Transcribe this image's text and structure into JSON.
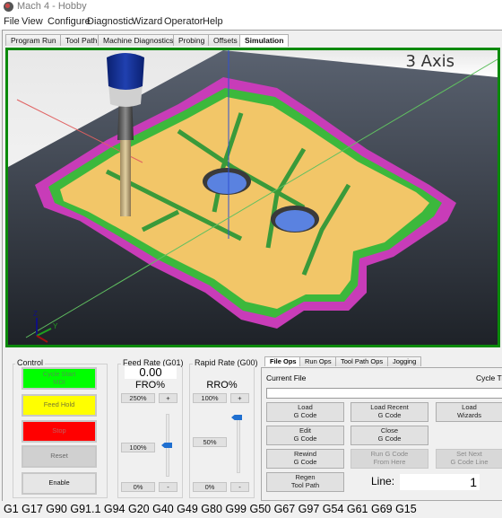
{
  "window": {
    "title": "Mach 4 - Hobby",
    "icon": "mach4-app-icon"
  },
  "menu": [
    "File",
    "View",
    "Configure",
    "Diagnostic",
    "Wizard",
    "Operator",
    "Help"
  ],
  "tabs": [
    {
      "label": "Program Run",
      "active": false
    },
    {
      "label": "Tool Path",
      "active": false
    },
    {
      "label": "Machine Diagnostics",
      "active": false
    },
    {
      "label": "Probing",
      "active": false
    },
    {
      "label": "Offsets",
      "active": false
    },
    {
      "label": "Simulation",
      "active": true
    }
  ],
  "viewport": {
    "mode_label": "3 Axis",
    "axis_indicator": {
      "x": "X",
      "y": "Y",
      "z": "Z"
    },
    "colors": {
      "border": "#0a8a0a",
      "part_floor": "#f0c060",
      "walls_green": "#4cc84c",
      "walls_magenta": "#e050d0",
      "holes": "#5a82e0",
      "stock": "#4a5060",
      "tool_holder": "#1a3aa8"
    }
  },
  "control": {
    "title": "Control",
    "buttons": [
      {
        "label": "Cycle Start\nMDI",
        "color": "#00ff00",
        "text_color": "#4a9a4a"
      },
      {
        "label": "Feed Hold",
        "color": "#ffff00",
        "text_color": "#7a7a30"
      },
      {
        "label": "Stop",
        "color": "#ff0000",
        "text_color": "#c06060"
      },
      {
        "label": "Reset",
        "color": "#d0d0d0",
        "text_color": "#6a6a6a"
      },
      {
        "label": "Enable",
        "color": "#e6e6e6",
        "text_color": "#111111"
      }
    ]
  },
  "feed_rate": {
    "title": "Feed Rate (G01)",
    "value": "0.00",
    "override_label": "FRO%",
    "max_label": "250%",
    "mid_label": "100%",
    "min_label": "0%",
    "plus": "+",
    "minus": "-",
    "override_percent": 100,
    "override_max": 250
  },
  "rapid_rate": {
    "title": "Rapid Rate (G00)",
    "override_label": "RRO%",
    "max_label": "100%",
    "mid_label": "50%",
    "min_label": "0%",
    "plus": "+",
    "minus": "-",
    "override_percent": 100,
    "override_max": 100
  },
  "file_ops": {
    "tabs": [
      {
        "label": "File Ops",
        "active": true
      },
      {
        "label": "Run Ops",
        "active": false
      },
      {
        "label": "Tool Path Ops",
        "active": false
      },
      {
        "label": "Jogging",
        "active": false
      }
    ],
    "current_file_label": "Current File",
    "current_file_value": "",
    "cycle_time_label": "Cycle Ti",
    "buttons": {
      "load_gcode": "Load\nG Code",
      "load_recent": "Load Recent\nG Code",
      "load_wizards": "Load\nWizards",
      "edit_gcode": "Edit\nG Code",
      "close_gcode": "Close\nG Code",
      "rewind_gcode": "Rewind\nG Code",
      "run_from_here": "Run G Code\nFrom Here",
      "set_next_line": "Set Next\nG Code Line",
      "regen_toolpath": "Regen\nTool Path"
    },
    "line_label": "Line:",
    "line_value": "1"
  },
  "gcode_status": "G1 G17 G90 G91.1 G94 G20 G40 G49 G80 G99 G50 G67 G97 G54 G61 G69 G15"
}
